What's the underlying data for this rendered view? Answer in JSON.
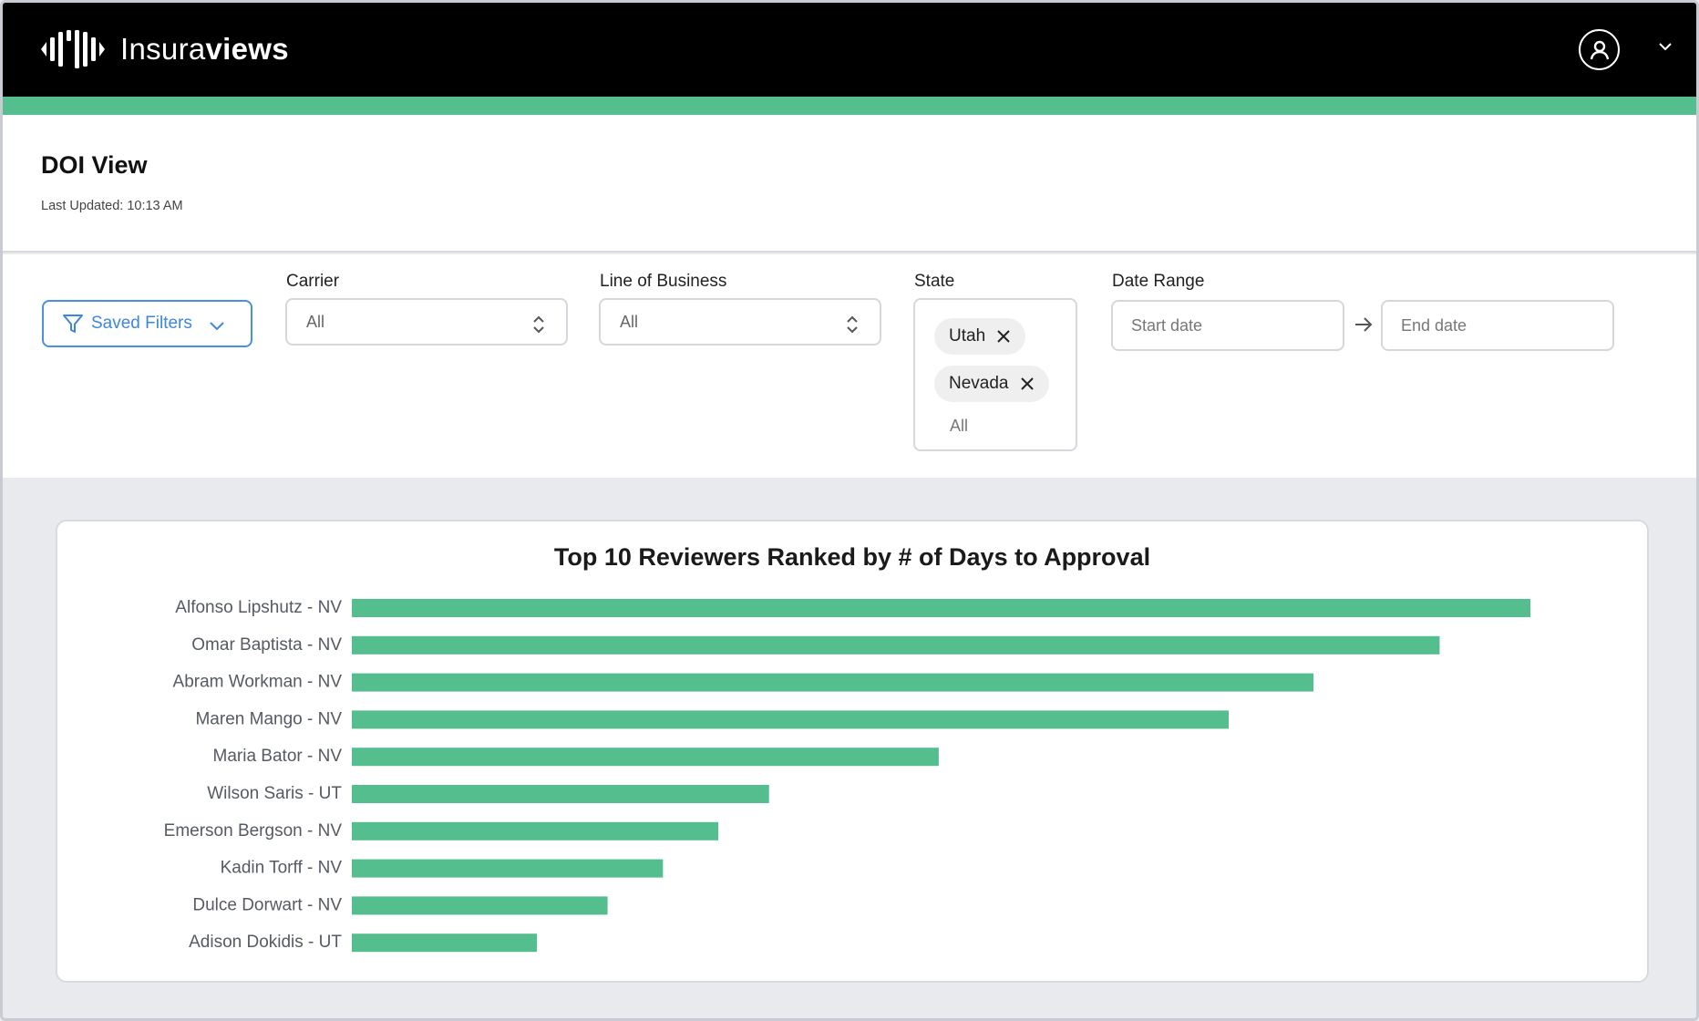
{
  "app": {
    "brand_light": "Insura",
    "brand_bold": "views",
    "colors": {
      "topbar": "#000000",
      "accent": "#55be8f",
      "link": "#3d87df"
    }
  },
  "header": {
    "title": "DOI View",
    "last_updated": "Last Updated: 10:13 AM"
  },
  "filters": {
    "saved_filters_label": "Saved Filters",
    "carrier": {
      "label": "Carrier",
      "value": "All"
    },
    "line_of_business": {
      "label": "Line of Business",
      "value": "All"
    },
    "state": {
      "label": "State",
      "selected": [
        "Utah",
        "Nevada"
      ],
      "placeholder": "All"
    },
    "date_range": {
      "label": "Date Range",
      "start_placeholder": "Start date",
      "end_placeholder": "End date"
    }
  },
  "icons": [
    "logo-icon",
    "user-icon",
    "chevron-down-icon",
    "filter-icon",
    "up-down-icon",
    "close-icon",
    "arrow-right-icon"
  ],
  "chart_data": {
    "type": "bar",
    "orientation": "horizontal",
    "title": "Top 10 Reviewers Ranked by # of Days to Approval",
    "categories": [
      "Alfonso Lipshutz - NV",
      "Omar Baptista - NV",
      "Abram Workman - NV",
      "Maren Mango - NV",
      "Maria Bator - NV",
      "Wilson Saris - UT",
      "Emerson Bergson - NV",
      "Kadin Torff - NV",
      "Dulce Dorwart - NV",
      "Adison Dokidis - UT"
    ],
    "values": [
      100,
      92.3,
      81.6,
      74.4,
      49.8,
      35.4,
      31.1,
      26.4,
      21.7,
      15.7
    ],
    "xlim": [
      0,
      100
    ],
    "bar_color": "#55be8f",
    "grid": false,
    "axis_ticks_shown": false
  }
}
